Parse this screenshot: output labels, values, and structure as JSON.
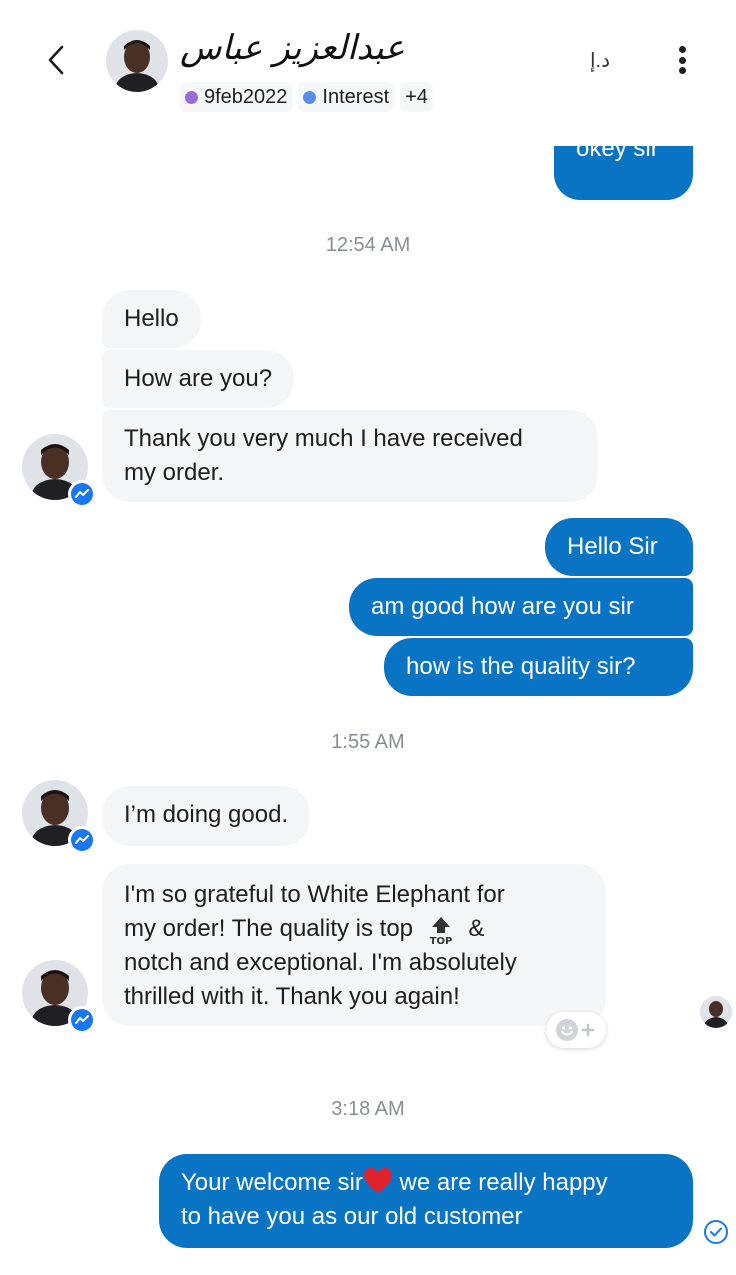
{
  "header": {
    "contact_name": "عبدالعزيز عباس",
    "translate_label": "د.إ",
    "tags": [
      {
        "label": "9feb2022",
        "color": "#9b6dd6"
      },
      {
        "label": "Interest",
        "color": "#5b8def"
      },
      {
        "label": "+4",
        "color": ""
      }
    ]
  },
  "messages": {
    "out_0": "okey sir",
    "ts_1": "12:54 AM",
    "in_1": "Hello",
    "in_2": "How are you?",
    "in_3_line1": "Thank you very much I have received",
    "in_3_line2": "my order.",
    "out_1": "Hello Sir",
    "out_2": "am good how are you sir",
    "out_3": "how is the quality sir?",
    "ts_2": "1:55 AM",
    "in_4": "I’m doing good.",
    "in_5_line1": "I'm so grateful to White Elephant for",
    "in_5_line2a": "my order! The quality is top",
    "in_5_line2b": "&",
    "in_5_line3": "notch and  exceptional. I'm absolutely",
    "in_5_line4": "thrilled with it. Thank you again!",
    "ts_3": "3:18 AM",
    "out_4_line1a": "Your welcome sir",
    "out_4_line1b": " we are really happy",
    "out_4_line2": "to have you as our old customer"
  },
  "colors": {
    "outgoing_bubble": "#0a74c4",
    "incoming_bubble": "#f4f5f7",
    "timestamp": "#8a8d91",
    "messenger_blue": "#1877f2"
  },
  "icons": [
    "chevron-left-icon",
    "translate-icon",
    "more-vertical-icon",
    "messenger-icon",
    "add-reaction-icon",
    "sent-check-icon",
    "top-arrow-emoji",
    "red-heart-emoji"
  ]
}
